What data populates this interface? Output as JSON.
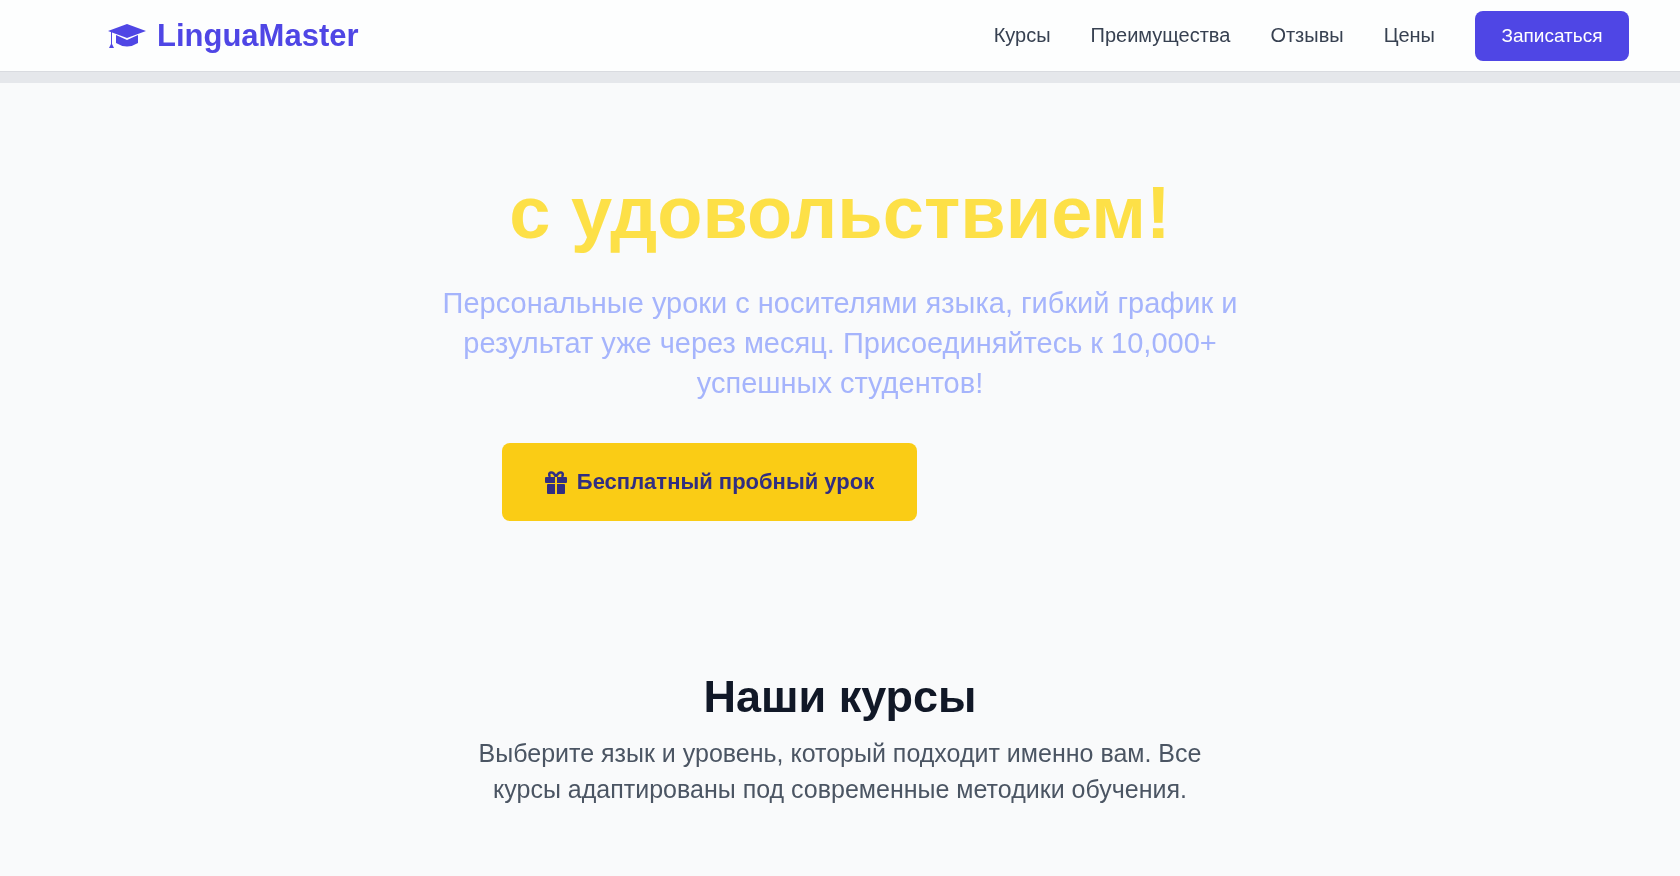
{
  "header": {
    "logo": "LinguaMaster",
    "nav": [
      "Курсы",
      "Преимущества",
      "Отзывы",
      "Цены"
    ],
    "cta": "Записаться"
  },
  "hero": {
    "title": "с удовольствием!",
    "subtitle": "Персональные уроки с носителями языка, гибкий график и результат уже через месяц. Присоединяйтесь к 10,000+ успешных студентов!",
    "button": "Бесплатный пробный урок"
  },
  "courses": {
    "title": "Наши курсы",
    "text": "Выберите язык и уровень, который подходит именно вам. Все курсы адаптированы под современные методики обучения."
  }
}
